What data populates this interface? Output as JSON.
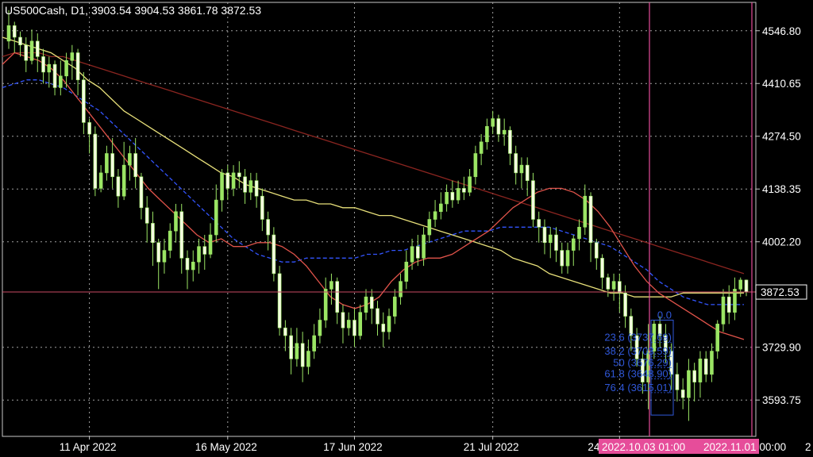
{
  "header": {
    "title": "US500Cash, D1, 3903.54 3904.53 3861.78 3872.53"
  },
  "current_price_label": "3872.53",
  "date_markers": [
    {
      "label": "2022.10.03 01:00"
    },
    {
      "label": "2022.11.01 00:00"
    }
  ],
  "edge_fragment": "2",
  "fibonacci": {
    "levels": [
      {
        "text": "0.0",
        "value": 0.0
      },
      {
        "text": "23.6 (3737.69)",
        "value": 23.6
      },
      {
        "text": "38.2 (3703.59)",
        "value": 38.2
      },
      {
        "text": "50 (3676.29)",
        "value": 50
      },
      {
        "text": "61.8 (3648.90)",
        "value": 61.8
      },
      {
        "text": "76.4 (3615.01)",
        "value": 76.4
      }
    ]
  },
  "chart_data": {
    "type": "candlestick",
    "title": "US500Cash, D1",
    "ohlc_last": {
      "open": 3903.54,
      "high": 3904.53,
      "low": 3861.78,
      "close": 3872.53
    },
    "y_ticks": [
      4546.8,
      4410.65,
      4274.5,
      4138.35,
      4002.2,
      3729.9,
      3593.75
    ],
    "y_tick_labels": [
      "4546.80",
      "4410.65",
      "4274.50",
      "4138.35",
      "4002.20",
      "3729.90",
      "3593.75"
    ],
    "ylim": [
      3500,
      4620
    ],
    "x_tick_labels": [
      "11 Apr 2022",
      "16 May 2022",
      "17 Jun 2022",
      "21 Jul 2022",
      "24 Aug 2022"
    ],
    "x_tick_index": [
      14,
      38,
      60,
      84,
      106
    ],
    "grid": true,
    "colors": {
      "background": "#000000",
      "candle": "#9be564",
      "candle_body": "#f4ffe0",
      "ma_fast": "#e0534a",
      "ma_mid": "#3355ff",
      "ma_slow": "#e8e07a",
      "ma_long": "#8b2520",
      "price_line": "#c74a64",
      "marker": "#e64d9a",
      "fib": "#2f57d8",
      "grid": "#a0a0a0"
    },
    "candles": [
      [
        4520,
        4560,
        4600,
        4500
      ],
      [
        4560,
        4530,
        4570,
        4490
      ],
      [
        4530,
        4510,
        4545,
        4480
      ],
      [
        4510,
        4470,
        4530,
        4440
      ],
      [
        4470,
        4520,
        4550,
        4460
      ],
      [
        4520,
        4480,
        4540,
        4440
      ],
      [
        4480,
        4440,
        4500,
        4410
      ],
      [
        4440,
        4460,
        4480,
        4400
      ],
      [
        4460,
        4400,
        4470,
        4380
      ],
      [
        4400,
        4430,
        4470,
        4380
      ],
      [
        4430,
        4470,
        4490,
        4400
      ],
      [
        4470,
        4490,
        4510,
        4420
      ],
      [
        4490,
        4420,
        4500,
        4380
      ],
      [
        4420,
        4310,
        4440,
        4280
      ],
      [
        4310,
        4280,
        4320,
        4230
      ],
      [
        4280,
        4140,
        4300,
        4120
      ],
      [
        4140,
        4180,
        4200,
        4130
      ],
      [
        4180,
        4230,
        4250,
        4160
      ],
      [
        4230,
        4170,
        4270,
        4140
      ],
      [
        4170,
        4120,
        4190,
        4090
      ],
      [
        4120,
        4200,
        4260,
        4110
      ],
      [
        4200,
        4230,
        4250,
        4160
      ],
      [
        4230,
        4170,
        4270,
        4140
      ],
      [
        4170,
        4090,
        4180,
        4060
      ],
      [
        4090,
        4050,
        4120,
        4000
      ],
      [
        4050,
        4000,
        4080,
        3940
      ],
      [
        4000,
        3950,
        4010,
        3880
      ],
      [
        3950,
        3980,
        4010,
        3920
      ],
      [
        3980,
        4030,
        4050,
        3960
      ],
      [
        4030,
        4080,
        4100,
        4000
      ],
      [
        4080,
        3960,
        4100,
        3920
      ],
      [
        3960,
        3930,
        3980,
        3880
      ],
      [
        3930,
        3950,
        3980,
        3900
      ],
      [
        3950,
        3990,
        4010,
        3920
      ],
      [
        3990,
        3970,
        4020,
        3930
      ],
      [
        3970,
        4020,
        4050,
        3960
      ],
      [
        4020,
        4110,
        4150,
        4000
      ],
      [
        4110,
        4180,
        4190,
        4080
      ],
      [
        4180,
        4140,
        4200,
        4110
      ],
      [
        4140,
        4180,
        4200,
        4120
      ],
      [
        4180,
        4170,
        4210,
        4140
      ],
      [
        4170,
        4130,
        4190,
        4100
      ],
      [
        4130,
        4160,
        4180,
        4110
      ],
      [
        4160,
        4120,
        4180,
        4090
      ],
      [
        4120,
        4060,
        4140,
        4030
      ],
      [
        4060,
        4020,
        4080,
        3980
      ],
      [
        4020,
        3920,
        4040,
        3900
      ],
      [
        3920,
        3780,
        3940,
        3760
      ],
      [
        3780,
        3760,
        3800,
        3720
      ],
      [
        3760,
        3700,
        3780,
        3660
      ],
      [
        3700,
        3740,
        3780,
        3680
      ],
      [
        3740,
        3680,
        3770,
        3640
      ],
      [
        3680,
        3720,
        3750,
        3660
      ],
      [
        3720,
        3760,
        3790,
        3700
      ],
      [
        3760,
        3800,
        3830,
        3740
      ],
      [
        3800,
        3880,
        3910,
        3780
      ],
      [
        3880,
        3900,
        3920,
        3840
      ],
      [
        3900,
        3820,
        3910,
        3790
      ],
      [
        3820,
        3780,
        3840,
        3740
      ],
      [
        3780,
        3800,
        3820,
        3760
      ],
      [
        3800,
        3760,
        3830,
        3730
      ],
      [
        3760,
        3820,
        3840,
        3750
      ],
      [
        3820,
        3860,
        3880,
        3800
      ],
      [
        3860,
        3830,
        3880,
        3790
      ],
      [
        3830,
        3790,
        3850,
        3760
      ],
      [
        3790,
        3770,
        3820,
        3730
      ],
      [
        3770,
        3810,
        3830,
        3750
      ],
      [
        3810,
        3860,
        3880,
        3790
      ],
      [
        3860,
        3900,
        3920,
        3840
      ],
      [
        3900,
        3950,
        3980,
        3880
      ],
      [
        3950,
        3990,
        4010,
        3930
      ],
      [
        3990,
        3960,
        4020,
        3940
      ],
      [
        3960,
        4020,
        4040,
        3940
      ],
      [
        4020,
        4060,
        4080,
        4000
      ],
      [
        4060,
        4080,
        4110,
        4040
      ],
      [
        4080,
        4100,
        4130,
        4060
      ],
      [
        4100,
        4130,
        4150,
        4080
      ],
      [
        4130,
        4110,
        4160,
        4090
      ],
      [
        4110,
        4140,
        4160,
        4100
      ],
      [
        4140,
        4130,
        4170,
        4110
      ],
      [
        4130,
        4170,
        4190,
        4120
      ],
      [
        4170,
        4230,
        4250,
        4150
      ],
      [
        4230,
        4260,
        4280,
        4200
      ],
      [
        4260,
        4300,
        4320,
        4240
      ],
      [
        4300,
        4320,
        4340,
        4280
      ],
      [
        4320,
        4280,
        4330,
        4260
      ],
      [
        4280,
        4290,
        4320,
        4250
      ],
      [
        4290,
        4230,
        4300,
        4200
      ],
      [
        4230,
        4180,
        4250,
        4150
      ],
      [
        4180,
        4200,
        4220,
        4140
      ],
      [
        4200,
        4160,
        4220,
        4120
      ],
      [
        4160,
        4060,
        4180,
        4040
      ],
      [
        4060,
        4040,
        4080,
        4000
      ],
      [
        4040,
        4000,
        4060,
        3970
      ],
      [
        4000,
        4020,
        4040,
        3960
      ],
      [
        4020,
        3980,
        4040,
        3950
      ],
      [
        3980,
        3940,
        4000,
        3920
      ],
      [
        3940,
        3980,
        4000,
        3920
      ],
      [
        3980,
        4010,
        4020,
        3940
      ],
      [
        4010,
        4040,
        4060,
        3980
      ],
      [
        4040,
        4120,
        4150,
        4020
      ],
      [
        4120,
        4000,
        4130,
        3950
      ],
      [
        4000,
        3960,
        4010,
        3930
      ],
      [
        3960,
        3910,
        3970,
        3880
      ],
      [
        3910,
        3880,
        3920,
        3860
      ],
      [
        3880,
        3900,
        3920,
        3850
      ],
      [
        3900,
        3870,
        3920,
        3820
      ],
      [
        3870,
        3810,
        3890,
        3780
      ],
      [
        3810,
        3760,
        3830,
        3720
      ],
      [
        3760,
        3700,
        3780,
        3680
      ],
      [
        3700,
        3640,
        3720,
        3610
      ],
      [
        3640,
        3720,
        3790,
        3570
      ],
      [
        3720,
        3790,
        3800,
        3700
      ],
      [
        3790,
        3760,
        3810,
        3730
      ],
      [
        3760,
        3720,
        3790,
        3690
      ],
      [
        3720,
        3660,
        3740,
        3620
      ],
      [
        3660,
        3620,
        3690,
        3590
      ],
      [
        3620,
        3600,
        3650,
        3570
      ],
      [
        3600,
        3670,
        3700,
        3540
      ],
      [
        3670,
        3640,
        3690,
        3590
      ],
      [
        3640,
        3700,
        3720,
        3600
      ],
      [
        3700,
        3660,
        3720,
        3640
      ],
      [
        3660,
        3720,
        3740,
        3640
      ],
      [
        3720,
        3790,
        3800,
        3700
      ],
      [
        3790,
        3860,
        3880,
        3770
      ],
      [
        3860,
        3820,
        3890,
        3790
      ],
      [
        3820,
        3880,
        3910,
        3800
      ],
      [
        3880,
        3903.54,
        3910,
        3860
      ],
      [
        3903.54,
        3872.53,
        3904.53,
        3861.78
      ]
    ],
    "ma_fast": [
      4460,
      4490,
      4480,
      4470,
      4450,
      4420,
      4380,
      4340,
      4300,
      4260,
      4220,
      4180,
      4140,
      4110,
      4080,
      4050,
      4020,
      4000,
      4010,
      3990,
      3990,
      4000,
      4000,
      3990,
      3970,
      3940,
      3900,
      3860,
      3840,
      3830,
      3840,
      3860,
      3900,
      3930,
      3950,
      3960,
      3960,
      3970,
      3990,
      4010,
      4030,
      4060,
      4090,
      4110,
      4130,
      4140,
      4140,
      4130,
      4110,
      4080,
      4040,
      3990,
      3940,
      3900,
      3870,
      3850,
      3830,
      3810,
      3790,
      3770,
      3760,
      3750
    ],
    "ma_mid": [
      4400,
      4410,
      4420,
      4420,
      4410,
      4400,
      4380,
      4360,
      4340,
      4310,
      4280,
      4250,
      4220,
      4190,
      4160,
      4130,
      4100,
      4070,
      4040,
      4010,
      3990,
      3970,
      3960,
      3950,
      3950,
      3960,
      3960,
      3960,
      3960,
      3960,
      3970,
      3970,
      3980,
      3980,
      3990,
      4000,
      4010,
      4020,
      4030,
      4030,
      4030,
      4040,
      4040,
      4040,
      4040,
      4040,
      4030,
      4020,
      4010,
      4000,
      3990,
      3970,
      3950,
      3930,
      3900,
      3880,
      3860,
      3850,
      3840,
      3840,
      3840,
      3840
    ],
    "ma_slow": [
      4530,
      4520,
      4510,
      4500,
      4490,
      4470,
      4450,
      4420,
      4400,
      4370,
      4340,
      4320,
      4300,
      4280,
      4260,
      4240,
      4220,
      4200,
      4180,
      4170,
      4150,
      4140,
      4130,
      4120,
      4110,
      4110,
      4100,
      4100,
      4090,
      4090,
      4080,
      4070,
      4070,
      4060,
      4050,
      4040,
      4030,
      4020,
      4010,
      4000,
      3990,
      3980,
      3960,
      3950,
      3940,
      3920,
      3910,
      3900,
      3890,
      3880,
      3870,
      3870,
      3860,
      3860,
      3860,
      3860,
      3870,
      3870,
      3870,
      3870,
      3870,
      3870
    ],
    "ma_long": [
      4480,
      4490,
      4490,
      4490,
      4480,
      4480,
      4470,
      4460,
      4450,
      4440,
      4430,
      4420,
      4410,
      4400,
      4390,
      4380,
      4370,
      4360,
      4350,
      4340,
      4330,
      4320,
      4310,
      4300,
      4290,
      4280,
      4270,
      4260,
      4250,
      4240,
      4230,
      4220,
      4210,
      4200,
      4190,
      4180,
      4170,
      4160,
      4150,
      4140,
      4130,
      4120,
      4110,
      4100,
      4090,
      4080,
      4070,
      4060,
      4050,
      4040,
      4030,
      4020,
      4010,
      4000,
      3990,
      3980,
      3970,
      3960,
      3950,
      3940,
      3930,
      3920
    ]
  }
}
